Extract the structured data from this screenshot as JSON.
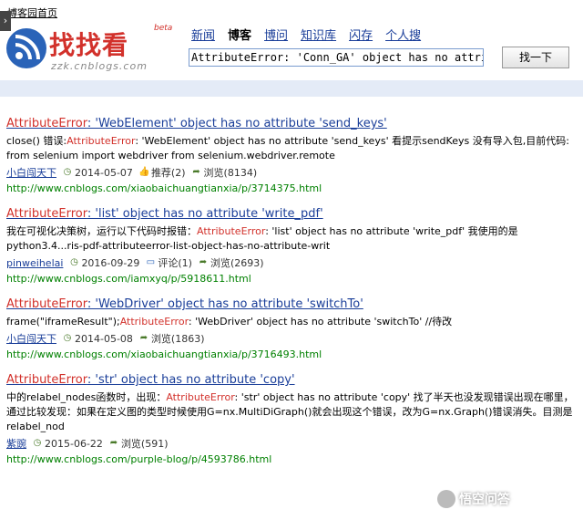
{
  "header": {
    "home_link": "博客园首页",
    "logo_text": "找找看",
    "logo_beta": "beta",
    "logo_domain": "zzk.cnblogs.com",
    "nav": [
      {
        "label": "新闻"
      },
      {
        "label": "博客",
        "active": true
      },
      {
        "label": "博问"
      },
      {
        "label": "知识库"
      },
      {
        "label": "闪存"
      },
      {
        "label": "个人搜"
      }
    ],
    "search_value": "AttributeError: 'Conn_GA' object has no attribute 'servic",
    "search_button": "找一下"
  },
  "results": [
    {
      "title_hl": "AttributeError",
      "title_rest": ": 'WebElement' object has no attribute 'send_keys'",
      "snippet_pre": "close() 错误:",
      "snippet_hl": "AttributeError",
      "snippet_post": ": 'WebElement' object has no attribute 'send_keys' 看提示sendKeys 没有导入包,目前代码: from selenium import webdriver from selenium.webdriver.remote",
      "author": "小白闯天下",
      "date": "2014-05-07",
      "extra": "推荐(2)",
      "views": "浏览(8134)",
      "url": "http://www.cnblogs.com/xiaobaichuangtianxia/p/3714375.html"
    },
    {
      "title_hl": "AttributeError",
      "title_rest": ": 'list' object has no attribute 'write_pdf'",
      "snippet_pre": "我在可视化决策树，运行以下代码时报错：",
      "snippet_hl": "AttributeError",
      "snippet_post": ": 'list' object has no attribute 'write_pdf' 我使用的是python3.4...ris-pdf-attributeerror-list-object-has-no-attribute-writ",
      "author": "pinweihelai",
      "date": "2016-09-29",
      "extra": "评论(1)",
      "views": "浏览(2693)",
      "url": "http://www.cnblogs.com/iamxyq/p/5918611.html"
    },
    {
      "title_hl": "AttributeError",
      "title_rest": ": 'WebDriver' object has no attribute 'switchTo'",
      "snippet_pre": "frame(\"iframeResult\");",
      "snippet_hl": "AttributeError",
      "snippet_post": ": 'WebDriver' object has no attribute 'switchTo' //待改",
      "author": "小白闯天下",
      "date": "2014-05-08",
      "extra": "",
      "views": "浏览(1863)",
      "url": "http://www.cnblogs.com/xiaobaichuangtianxia/p/3716493.html"
    },
    {
      "title_hl": "AttributeError",
      "title_rest": ": 'str' object has no attribute 'copy'",
      "snippet_pre": "中的relabel_nodes函数时，出现：",
      "snippet_hl": "AttributeError",
      "snippet_post": ": 'str' object has no attribute 'copy' 找了半天也没发现错误出现在哪里，通过比较发现：如果在定义图的类型时候使用G=nx.MultiDiGraph()就会出现这个错误，改为G=nx.Graph()错误消失。目测是relabel_nod",
      "author": "紫豌",
      "date": "2015-06-22",
      "extra": "",
      "views": "浏览(591)",
      "url": "http://www.cnblogs.com/purple-blog/p/4593786.html"
    }
  ],
  "watermark": "悟空问答"
}
